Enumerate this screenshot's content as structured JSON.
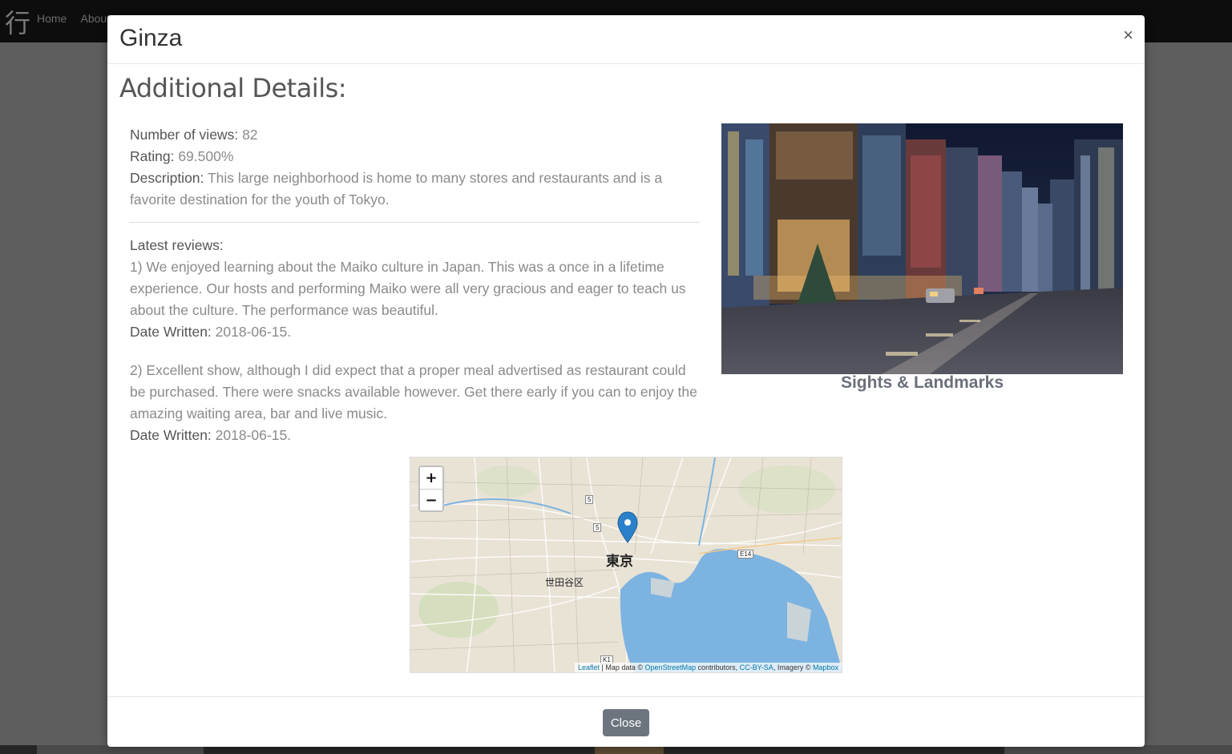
{
  "background": {
    "logo": "行",
    "nav": [
      "Home",
      "About"
    ]
  },
  "modal": {
    "title": "Ginza",
    "close_symbol": "×",
    "section_title": "Additional Details:",
    "details": {
      "views_label": "Number of views:",
      "views_value": "82",
      "rating_label": "Rating:",
      "rating_value": "69.500%",
      "description_label": "Description:",
      "description_value": "This large neighborhood is home to many stores and restaurants and is a favorite destination for the youth of Tokyo."
    },
    "reviews_label": "Latest reviews:",
    "reviews": [
      {
        "text": "1) We enjoyed learning about the Maiko culture in Japan. This was a once in a lifetime experience. Our hosts and performing Maiko were all very gracious and eager to teach us about the culture. The performance was beautiful.",
        "date_label": "Date Written:",
        "date_value": "2018-06-15."
      },
      {
        "text": "2) Excellent show, although I did expect that a proper meal advertised as restaurant could be purchased. There were snacks available however. Get there early if you can to enjoy the amazing waiting area, bar and live music.",
        "date_label": "Date Written:",
        "date_value": "2018-06-15."
      }
    ],
    "image_caption": "Sights & Landmarks",
    "map": {
      "zoom_in": "+",
      "zoom_out": "−",
      "labels": {
        "city": "東京",
        "ward": "世田谷区",
        "road1": "5",
        "road2": "5",
        "road3": "E14",
        "road4": "K1"
      },
      "attribution": {
        "leaflet": "Leaflet",
        "sep1": " | Map data © ",
        "osm": "OpenStreetMap",
        "contributors": " contributors, ",
        "license": "CC-BY-SA",
        "imagery": ", Imagery © ",
        "mapbox": "Mapbox"
      },
      "water_color": "#7cb3e0",
      "land_color": "#e9e3d6",
      "marker_color": "#2a81cb"
    },
    "footer": {
      "close_label": "Close"
    }
  }
}
